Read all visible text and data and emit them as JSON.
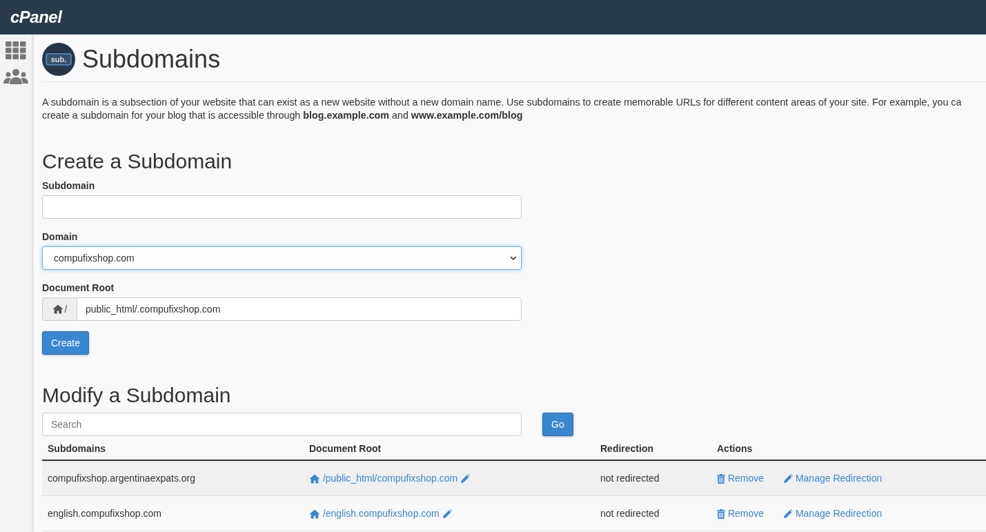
{
  "topbar": {
    "logo": "cPanel"
  },
  "sidebar": {
    "items": [
      {
        "kind": "apps"
      },
      {
        "kind": "users"
      }
    ]
  },
  "page": {
    "badge": "sub.",
    "title": "Subdomains"
  },
  "description_lines": [
    "A subdomain is a subsection of your website that can exist as a new website without a new domain name. Use subdomains to create memorable URLs for different content areas of your site. For example, you ca",
    "create a subdomain for your blog that is accessible through **blog.example.com** and **www.example.com/blog**"
  ],
  "create": {
    "heading": "Create a Subdomain",
    "fields": [
      {
        "kind": "text",
        "label": "Subdomain"
      },
      {
        "kind": "select",
        "label": "Domain",
        "value": "compufixshop.com",
        "focused": true
      },
      {
        "kind": "docroot",
        "label": "Document Root",
        "prefix": "/",
        "value": "public_html/.compufixshop.com"
      }
    ],
    "button": "Create"
  },
  "modify": {
    "heading": "Modify a Subdomain",
    "search": {
      "placeholder": "Search"
    },
    "go_button": "Go",
    "table": {
      "columns": [
        "Subdomains",
        "Document Root",
        "Redirection",
        "Actions"
      ],
      "rows": [
        {
          "subdomain": "compufixshop.argentinaexpats.org",
          "document_root": "/public_html/compufixshop.com",
          "redirection": "not redirected",
          "actions": [
            "Remove",
            "Manage Redirection"
          ]
        },
        {
          "subdomain": "english.compufixshop.com",
          "document_root": "/english.compufixshop.com",
          "redirection": "not redirected",
          "actions": [
            "Remove",
            "Manage Redirection"
          ]
        }
      ]
    }
  }
}
